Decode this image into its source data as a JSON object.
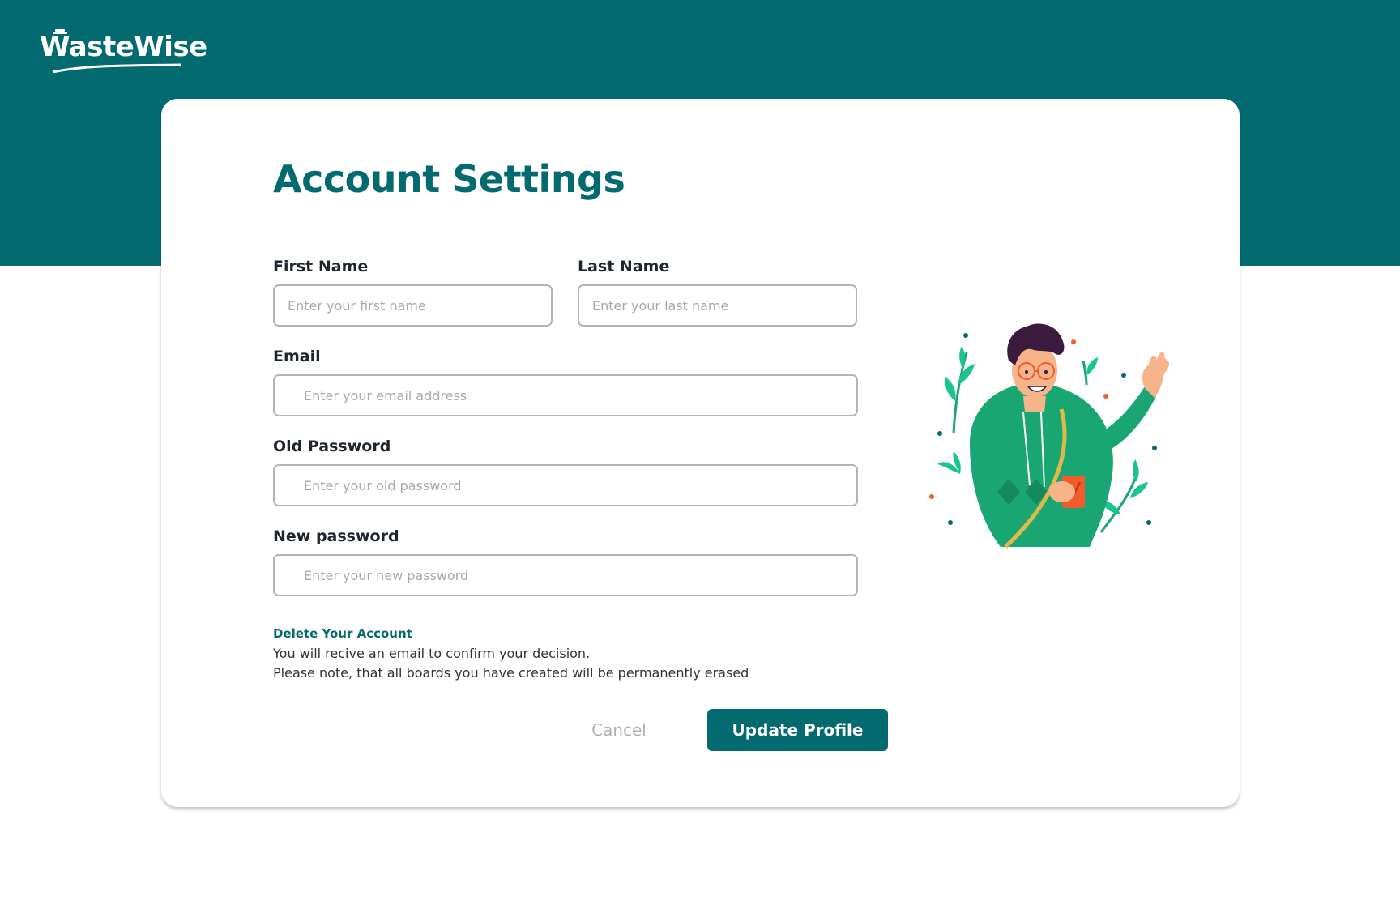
{
  "brand": {
    "name": "WasteWise"
  },
  "page": {
    "title": "Account Settings"
  },
  "form": {
    "first_name": {
      "label": "First Name",
      "placeholder": "Enter your first name",
      "value": ""
    },
    "last_name": {
      "label": "Last Name",
      "placeholder": "Enter your last name",
      "value": ""
    },
    "email": {
      "label": "Email",
      "placeholder": "Enter your email address",
      "value": ""
    },
    "old_password": {
      "label": "Old Password",
      "placeholder": "Enter your old password",
      "value": ""
    },
    "new_password": {
      "label": "New password",
      "placeholder": "Enter your new password",
      "value": ""
    }
  },
  "delete_account": {
    "title": "Delete Your Account",
    "line1": "You will recive an email to confirm your decision.",
    "line2": "Please note, that all boards you have created will be permanently erased"
  },
  "actions": {
    "cancel_label": "Cancel",
    "update_label": "Update Profile"
  },
  "colors": {
    "brand": "#036b70",
    "illustration_green": "#19a672",
    "accent_orange": "#f25c2a"
  },
  "icons": {
    "logo": "trash-can-logo-icon",
    "illustration": "waving-person-illustration"
  }
}
